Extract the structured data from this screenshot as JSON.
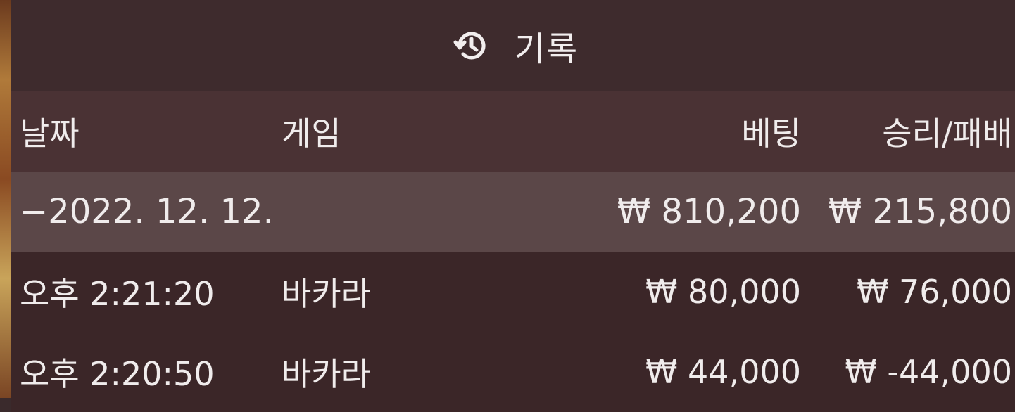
{
  "header": {
    "icon": "history-icon",
    "title": "기록"
  },
  "columns": {
    "date": "날짜",
    "game": "게임",
    "bet": "베팅",
    "win_loss": "승리/패배"
  },
  "summary": {
    "date": "−2022. 12. 12.",
    "bet": "₩ 810,200",
    "win_loss": "₩ 215,800"
  },
  "rows": [
    {
      "time": "오후 2:21:20",
      "game": "바카라",
      "bet": "₩ 80,000",
      "win_loss": "₩ 76,000"
    },
    {
      "time": "오후 2:20:50",
      "game": "바카라",
      "bet": "₩ 44,000",
      "win_loss": "₩ -44,000"
    }
  ],
  "colors": {
    "panel_bg": "#3b2628",
    "header_bg": "#3e2b2d",
    "column_header_bg": "#4a3234",
    "summary_row_bg": "#5b4748",
    "text": "#f0ecec"
  }
}
